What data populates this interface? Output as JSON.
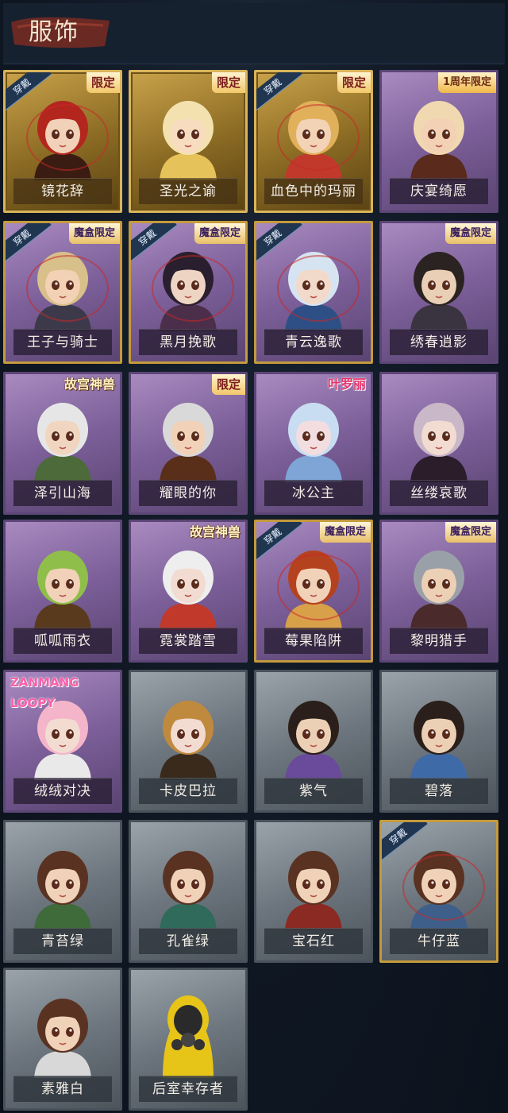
{
  "header": {
    "title": "服饰"
  },
  "colors": {
    "background": "#0f1723",
    "gold": "#c9a24a",
    "purple": "#7c5f99",
    "grey": "#6d767e",
    "label_text": "#f3eee6"
  },
  "costumes": [
    {
      "name": "镜花辞",
      "rarity": "gold",
      "worn_label": "穿戴",
      "tag": "限定",
      "tag_style": "limited",
      "icon": "red-hooded-girl"
    },
    {
      "name": "圣光之谕",
      "rarity": "gold",
      "worn_label": "",
      "tag": "限定",
      "tag_style": "limited",
      "icon": "blonde-veiled-girl"
    },
    {
      "name": "血色中的玛丽",
      "rarity": "gold",
      "worn_label": "穿戴",
      "tag": "限定",
      "tag_style": "limited",
      "icon": "curly-blonde-girl"
    },
    {
      "name": "庆宴绮愿",
      "rarity": "purple",
      "worn_label": "",
      "tag": "1周年限定",
      "tag_style": "anniv",
      "icon": "cake-girl"
    },
    {
      "name": "王子与骑士",
      "rarity": "purple",
      "worn_label": "穿戴",
      "tag": "魔盒限定",
      "tag_style": "box",
      "icon": "prince-knight"
    },
    {
      "name": "黑月挽歌",
      "rarity": "purple",
      "worn_label": "穿戴",
      "tag": "魔盒限定",
      "tag_style": "box",
      "icon": "dark-haired-girl"
    },
    {
      "name": "青云逸歌",
      "rarity": "purple",
      "worn_label": "穿戴",
      "tag": "",
      "tag_style": "",
      "icon": "white-haired-boy"
    },
    {
      "name": "绣春逍影",
      "rarity": "purple",
      "worn_label": "",
      "tag": "魔盒限定",
      "tag_style": "box",
      "icon": "swordsman"
    },
    {
      "name": "泽引山海",
      "rarity": "purple",
      "worn_label": "",
      "tag": "故宫神兽",
      "tag_style": "gugong",
      "icon": "silver-haired-boy"
    },
    {
      "name": "耀眼的你",
      "rarity": "purple",
      "worn_label": "",
      "tag": "限定",
      "tag_style": "limited",
      "icon": "cowboy-hat-girl"
    },
    {
      "name": "冰公主",
      "rarity": "purple",
      "worn_label": "",
      "tag": "叶罗丽",
      "tag_style": "luoli",
      "icon": "ice-princess"
    },
    {
      "name": "丝缕哀歌",
      "rarity": "purple",
      "worn_label": "",
      "tag": "",
      "tag_style": "",
      "icon": "lace-girl"
    },
    {
      "name": "呱呱雨衣",
      "rarity": "purple",
      "worn_label": "",
      "tag": "",
      "tag_style": "",
      "icon": "frog-raincoat"
    },
    {
      "name": "霓裳踏雪",
      "rarity": "purple",
      "worn_label": "",
      "tag": "故宫神兽",
      "tag_style": "gugong",
      "icon": "snow-girl"
    },
    {
      "name": "莓果陷阱",
      "rarity": "purple",
      "worn_label": "穿戴",
      "tag": "魔盒限定",
      "tag_style": "box",
      "icon": "berry-hat-girl"
    },
    {
      "name": "黎明猎手",
      "rarity": "purple",
      "worn_label": "",
      "tag": "魔盒限定",
      "tag_style": "box",
      "icon": "hunter-boy"
    },
    {
      "name": "绒绒对决",
      "rarity": "purple",
      "worn_label": "",
      "tag": "ZANMANG LOOPY",
      "tag_style": "loopy",
      "icon": "loopy-hood"
    },
    {
      "name": "卡皮巴拉",
      "rarity": "grey",
      "worn_label": "",
      "tag": "",
      "tag_style": "",
      "icon": "capybara-hood"
    },
    {
      "name": "紫气",
      "rarity": "grey",
      "worn_label": "",
      "tag": "",
      "tag_style": "",
      "icon": "boy-purple"
    },
    {
      "name": "碧落",
      "rarity": "grey",
      "worn_label": "",
      "tag": "",
      "tag_style": "",
      "icon": "boy-blue"
    },
    {
      "name": "青苔绿",
      "rarity": "grey",
      "worn_label": "",
      "tag": "",
      "tag_style": "",
      "icon": "girl-green"
    },
    {
      "name": "孔雀绿",
      "rarity": "grey",
      "worn_label": "",
      "tag": "",
      "tag_style": "",
      "icon": "girl-teal"
    },
    {
      "name": "宝石红",
      "rarity": "grey",
      "worn_label": "",
      "tag": "",
      "tag_style": "",
      "icon": "girl-red"
    },
    {
      "name": "牛仔蓝",
      "rarity": "grey",
      "worn_label": "穿戴",
      "tag": "",
      "tag_style": "",
      "icon": "girl-denim"
    },
    {
      "name": "素雅白",
      "rarity": "grey",
      "worn_label": "",
      "tag": "",
      "tag_style": "",
      "icon": "girl-white"
    },
    {
      "name": "后室幸存者",
      "rarity": "grey",
      "worn_label": "",
      "tag": "",
      "tag_style": "",
      "icon": "gasmask-survivor"
    }
  ]
}
